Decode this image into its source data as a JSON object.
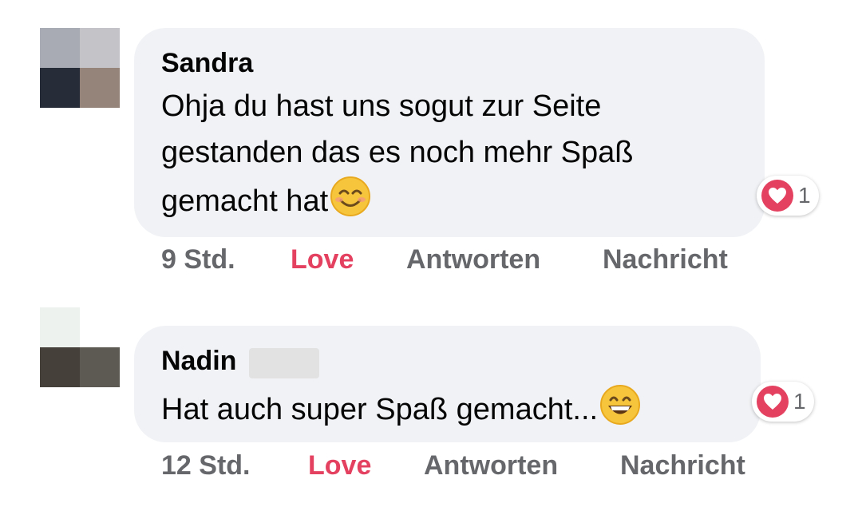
{
  "comments": [
    {
      "author": "Sandra",
      "text_lines": [
        "Ohja du hast uns sogut zur Seite",
        "gestanden das es noch mehr Spaß",
        "gemacht hat"
      ],
      "emoji": "smiling-face-with-smiling-eyes",
      "reaction_count": "1",
      "actions": {
        "time": "9 Std.",
        "love": "Love",
        "reply": "Antworten",
        "message": "Nachricht"
      }
    },
    {
      "author": "Nadin",
      "text_lines": [
        "Hat auch super Spaß gemacht..."
      ],
      "emoji": "grinning-face-with-smiling-eyes",
      "reaction_count": "1",
      "actions": {
        "time": "12 Std.",
        "love": "Love",
        "reply": "Antworten",
        "message": "Nachricht"
      }
    }
  ],
  "colors": {
    "bubble": "#f0f2f5",
    "love": "#e4405f",
    "meta": "#65676b",
    "text": "#050505"
  }
}
